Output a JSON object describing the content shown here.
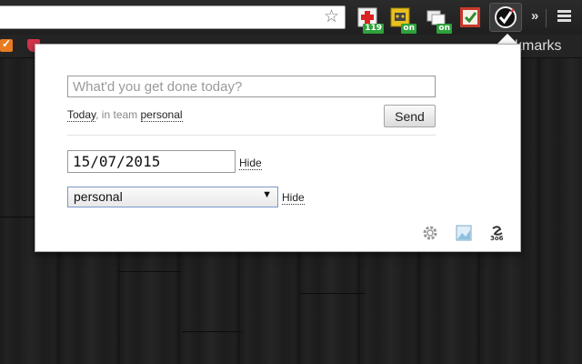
{
  "browser": {
    "extensions": [
      {
        "name": "first-aid-icon",
        "badge": "119"
      },
      {
        "name": "robot-icon",
        "badge": "on"
      },
      {
        "name": "cloud-icon",
        "badge": "on"
      },
      {
        "name": "checklist-icon",
        "badge": ""
      },
      {
        "name": "checkmark-icon",
        "badge": ""
      }
    ],
    "bookmarks_label": "kmarks"
  },
  "popup": {
    "done_placeholder": "What'd you get done today?",
    "context": {
      "date_word": "Today",
      "team_prefix": ", in team ",
      "team_name": "personal"
    },
    "send_label": "Send",
    "date_value": "15/07/2015",
    "date_hide_label": "Hide",
    "team_select_value": "personal",
    "team_hide_label": "Hide",
    "footer_icons": [
      "gear-icon",
      "image-icon",
      "logo-icon"
    ]
  },
  "colors": {
    "badge_green": "#2ea23c",
    "select_border": "#7b96c9"
  }
}
